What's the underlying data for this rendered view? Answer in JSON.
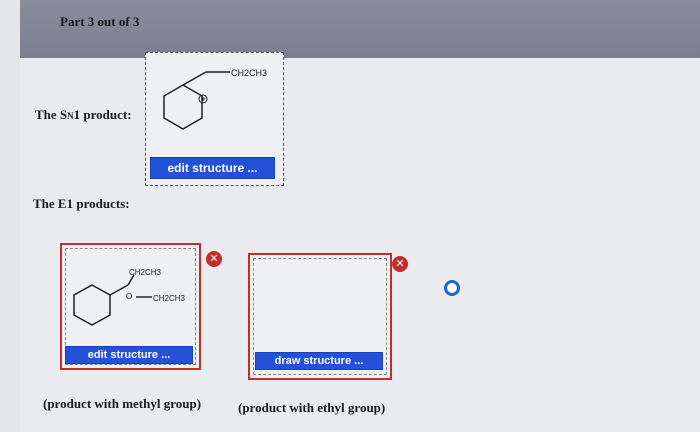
{
  "header": {
    "title": "Part 3 out of 3"
  },
  "sn1": {
    "label_pre": "The S",
    "label_sub": "N",
    "label_post": "1 product:",
    "edit_button": "edit structure ...",
    "structure": {
      "substituent": "CH2CH3",
      "charge": "+"
    }
  },
  "e1": {
    "label": "The E1 products:",
    "left": {
      "edit_button": "edit structure ...",
      "caption": "(product with methyl group)",
      "structure": {
        "top": "CH2CH3",
        "right": "CH2CH3",
        "atom": "O"
      }
    },
    "right": {
      "draw_button": "draw structure ...",
      "caption": "(product with ethyl group)"
    }
  },
  "icons": {
    "close": "close-icon",
    "radio": "radio-button-icon"
  },
  "colors": {
    "accent": "#2550d8",
    "danger": "#c0302a",
    "header": "#7b7e8e"
  }
}
